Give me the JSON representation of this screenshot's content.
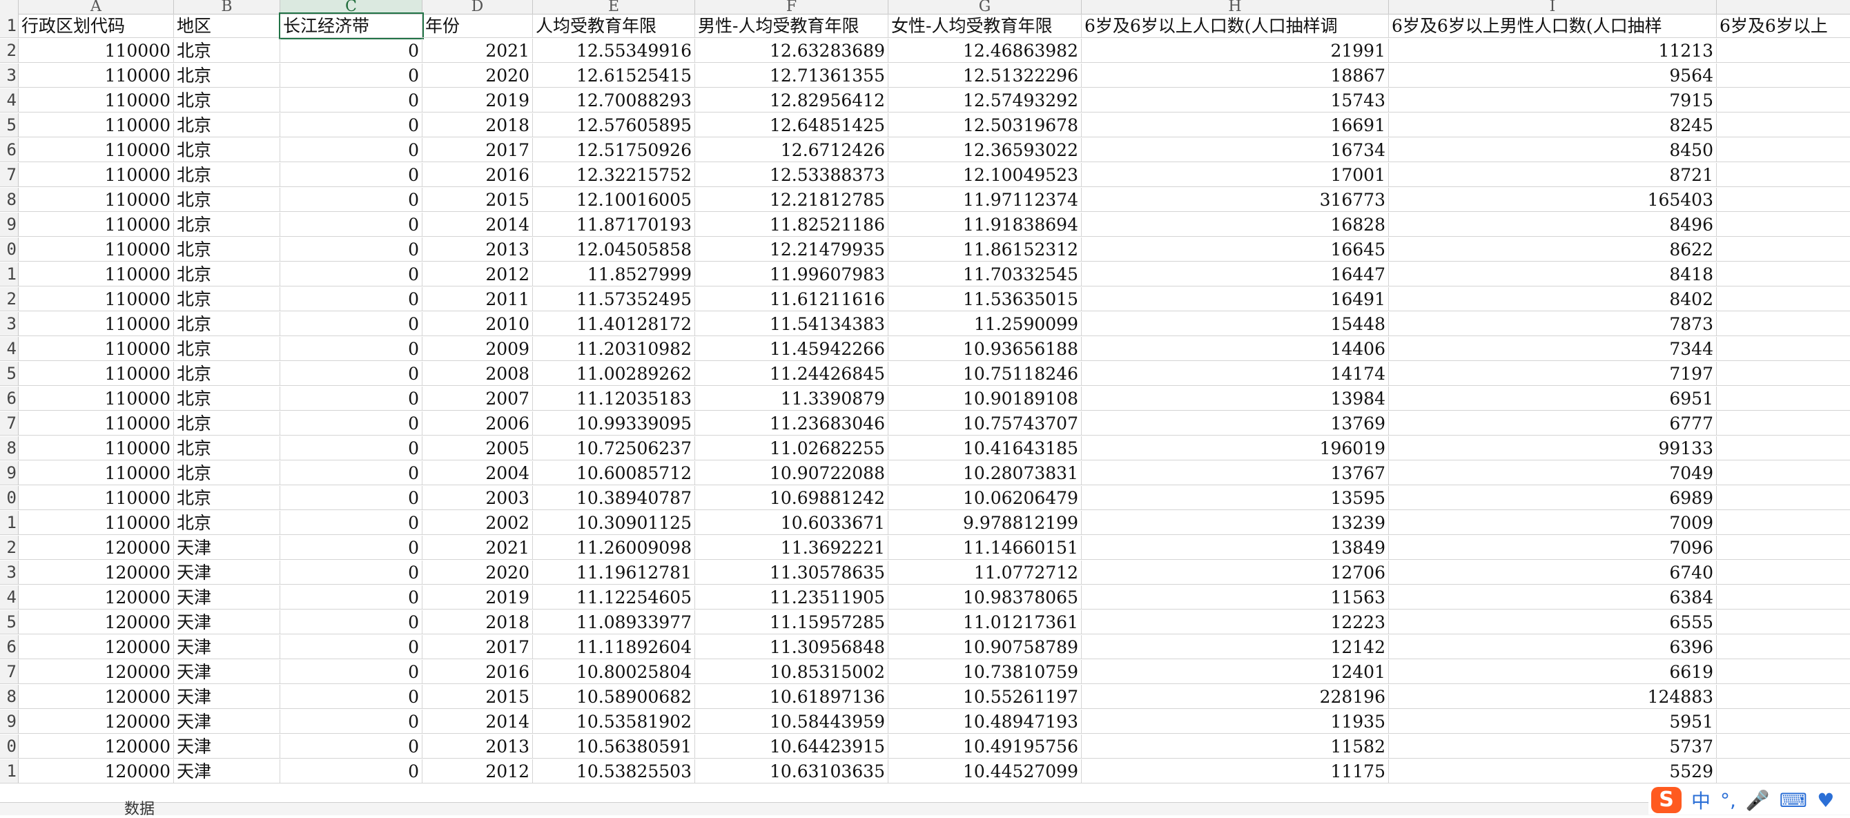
{
  "app": {
    "selected_column": "C",
    "sheet_tab": "数据"
  },
  "columns": [
    "A",
    "B",
    "C",
    "D",
    "E",
    "F",
    "G",
    "H",
    "I",
    ""
  ],
  "row_numbers": [
    "1",
    "2",
    "3",
    "4",
    "5",
    "6",
    "7",
    "8",
    "9",
    "0",
    "1",
    "2",
    "3",
    "4",
    "5",
    "6",
    "7",
    "8",
    "9",
    "0",
    "1",
    "2",
    "3",
    "4",
    "5",
    "6",
    "7",
    "8",
    "9",
    "0",
    "1"
  ],
  "headers": [
    "行政区划代码",
    "地区",
    "长江经济带",
    "年份",
    "人均受教育年限",
    "男性-人均受教育年限",
    "女性-人均受教育年限",
    "6岁及6岁以上人口数(人口抽样调",
    "6岁及6岁以上男性人口数(人口抽样",
    "6岁及6岁以上"
  ],
  "rows": [
    [
      "110000",
      "北京",
      "0",
      "2021",
      "12.55349916",
      "12.63283689",
      "12.46863982",
      "21991",
      "11213",
      ""
    ],
    [
      "110000",
      "北京",
      "0",
      "2020",
      "12.61525415",
      "12.71361355",
      "12.51322296",
      "18867",
      "9564",
      ""
    ],
    [
      "110000",
      "北京",
      "0",
      "2019",
      "12.70088293",
      "12.82956412",
      "12.57493292",
      "15743",
      "7915",
      ""
    ],
    [
      "110000",
      "北京",
      "0",
      "2018",
      "12.57605895",
      "12.64851425",
      "12.50319678",
      "16691",
      "8245",
      ""
    ],
    [
      "110000",
      "北京",
      "0",
      "2017",
      "12.51750926",
      "12.6712426",
      "12.36593022",
      "16734",
      "8450",
      ""
    ],
    [
      "110000",
      "北京",
      "0",
      "2016",
      "12.32215752",
      "12.53388373",
      "12.10049523",
      "17001",
      "8721",
      ""
    ],
    [
      "110000",
      "北京",
      "0",
      "2015",
      "12.10016005",
      "12.21812785",
      "11.97112374",
      "316773",
      "165403",
      ""
    ],
    [
      "110000",
      "北京",
      "0",
      "2014",
      "11.87170193",
      "11.82521186",
      "11.91838694",
      "16828",
      "8496",
      ""
    ],
    [
      "110000",
      "北京",
      "0",
      "2013",
      "12.04505858",
      "12.21479935",
      "11.86152312",
      "16645",
      "8622",
      ""
    ],
    [
      "110000",
      "北京",
      "0",
      "2012",
      "11.8527999",
      "11.99607983",
      "11.70332545",
      "16447",
      "8418",
      ""
    ],
    [
      "110000",
      "北京",
      "0",
      "2011",
      "11.57352495",
      "11.61211616",
      "11.53635015",
      "16491",
      "8402",
      ""
    ],
    [
      "110000",
      "北京",
      "0",
      "2010",
      "11.40128172",
      "11.54134383",
      "11.2590099",
      "15448",
      "7873",
      ""
    ],
    [
      "110000",
      "北京",
      "0",
      "2009",
      "11.20310982",
      "11.45942266",
      "10.93656188",
      "14406",
      "7344",
      ""
    ],
    [
      "110000",
      "北京",
      "0",
      "2008",
      "11.00289262",
      "11.24426845",
      "10.75118246",
      "14174",
      "7197",
      ""
    ],
    [
      "110000",
      "北京",
      "0",
      "2007",
      "11.12035183",
      "11.3390879",
      "10.90189108",
      "13984",
      "6951",
      ""
    ],
    [
      "110000",
      "北京",
      "0",
      "2006",
      "10.99339095",
      "11.23683046",
      "10.75743707",
      "13769",
      "6777",
      ""
    ],
    [
      "110000",
      "北京",
      "0",
      "2005",
      "10.72506237",
      "11.02682255",
      "10.41643185",
      "196019",
      "99133",
      ""
    ],
    [
      "110000",
      "北京",
      "0",
      "2004",
      "10.60085712",
      "10.90722088",
      "10.28073831",
      "13767",
      "7049",
      ""
    ],
    [
      "110000",
      "北京",
      "0",
      "2003",
      "10.38940787",
      "10.69881242",
      "10.06206479",
      "13595",
      "6989",
      ""
    ],
    [
      "110000",
      "北京",
      "0",
      "2002",
      "10.30901125",
      "10.6033671",
      "9.978812199",
      "13239",
      "7009",
      ""
    ],
    [
      "120000",
      "天津",
      "0",
      "2021",
      "11.26009098",
      "11.3692221",
      "11.14660151",
      "13849",
      "7096",
      ""
    ],
    [
      "120000",
      "天津",
      "0",
      "2020",
      "11.19612781",
      "11.30578635",
      "11.0772712",
      "12706",
      "6740",
      ""
    ],
    [
      "120000",
      "天津",
      "0",
      "2019",
      "11.12254605",
      "11.23511905",
      "10.98378065",
      "11563",
      "6384",
      ""
    ],
    [
      "120000",
      "天津",
      "0",
      "2018",
      "11.08933977",
      "11.15957285",
      "11.01217361",
      "12223",
      "6555",
      ""
    ],
    [
      "120000",
      "天津",
      "0",
      "2017",
      "11.11892604",
      "11.30956848",
      "10.90758789",
      "12142",
      "6396",
      ""
    ],
    [
      "120000",
      "天津",
      "0",
      "2016",
      "10.80025804",
      "10.85315002",
      "10.73810759",
      "12401",
      "6619",
      ""
    ],
    [
      "120000",
      "天津",
      "0",
      "2015",
      "10.58900682",
      "10.61897136",
      "10.55261197",
      "228196",
      "124883",
      ""
    ],
    [
      "120000",
      "天津",
      "0",
      "2014",
      "10.53581902",
      "10.58443959",
      "10.48947193",
      "11935",
      "5951",
      ""
    ],
    [
      "120000",
      "天津",
      "0",
      "2013",
      "10.56380591",
      "10.64423915",
      "10.49195756",
      "11582",
      "5737",
      ""
    ],
    [
      "120000",
      "天津",
      "0",
      "2012",
      "10.53825503",
      "10.63103635",
      "10.44527099",
      "11175",
      "5529",
      ""
    ]
  ],
  "ime": {
    "label": "中",
    "icons": [
      "punct-icon",
      "mic-icon",
      "keyboard-icon",
      "skin-icon"
    ]
  }
}
